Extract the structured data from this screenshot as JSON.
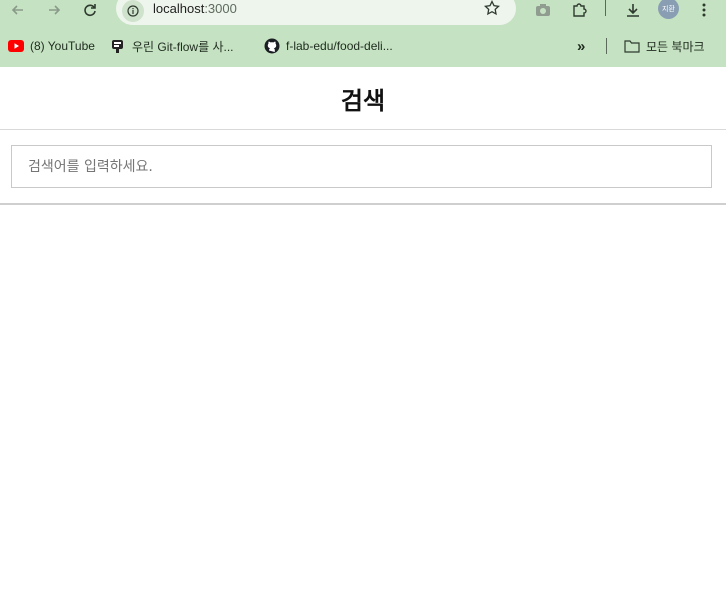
{
  "browser": {
    "url_host": "localhost",
    "url_port": ":3000",
    "profile_initials": "지환",
    "bookmarks": [
      {
        "label": "(8) YouTube",
        "icon": "youtube-icon"
      },
      {
        "label": "우린 Git-flow를 사...",
        "icon": "site-icon"
      },
      {
        "label": "f-lab-edu/food-deli...",
        "icon": "github-icon"
      }
    ],
    "overflow_label": "»",
    "all_bookmarks_label": "모든 북마크"
  },
  "page": {
    "title": "검색",
    "search_placeholder": "검색어를 입력하세요.",
    "search_value": ""
  },
  "colors": {
    "chrome_bg": "#c5e3c2",
    "omnibox_bg": "#eef5ec",
    "youtube_red": "#ff0000"
  }
}
